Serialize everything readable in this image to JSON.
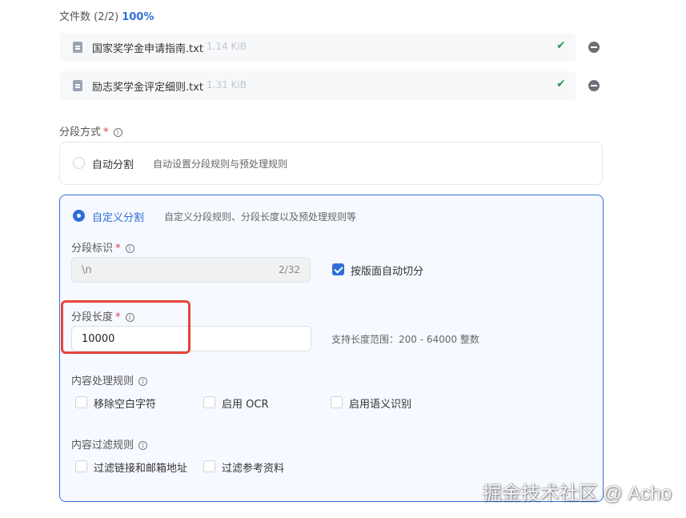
{
  "files": {
    "count_label": "文件数 (2/2)",
    "progress": "100%",
    "items": [
      {
        "name": "国家奖学金申请指南.txt",
        "size": "1.14 KiB"
      },
      {
        "name": "励志奖学金评定细则.txt",
        "size": "1.31 KiB"
      }
    ]
  },
  "segmentation": {
    "label": "分段方式",
    "required_mark": "*",
    "auto": {
      "title": "自动分割",
      "desc": "自动设置分段规则与预处理规则"
    },
    "custom": {
      "title": "自定义分割",
      "desc": "自定义分段规则、分段长度以及预处理规则等"
    }
  },
  "custom_form": {
    "identifier_label": "分段标识",
    "identifier_value": "\\n",
    "identifier_count": "2/32",
    "page_split_label": "按版面自动切分",
    "length_label": "分段长度",
    "length_value": "10000",
    "length_hint": "支持长度范围：200 - 64000 整数",
    "content_rules_label": "内容处理规则",
    "content_rules": [
      "移除空白字符",
      "启用 OCR",
      "启用语义识别"
    ],
    "filter_rules_label": "内容过滤规则",
    "filter_rules": [
      "过滤链接和邮箱地址",
      "过滤参考资料"
    ]
  },
  "watermark": "掘金技术社区 @ Acho",
  "colors": {
    "accent": "#2f6fd6",
    "required": "#e03b3b",
    "highlight": "#e5453d",
    "success": "#2e9a5b"
  }
}
